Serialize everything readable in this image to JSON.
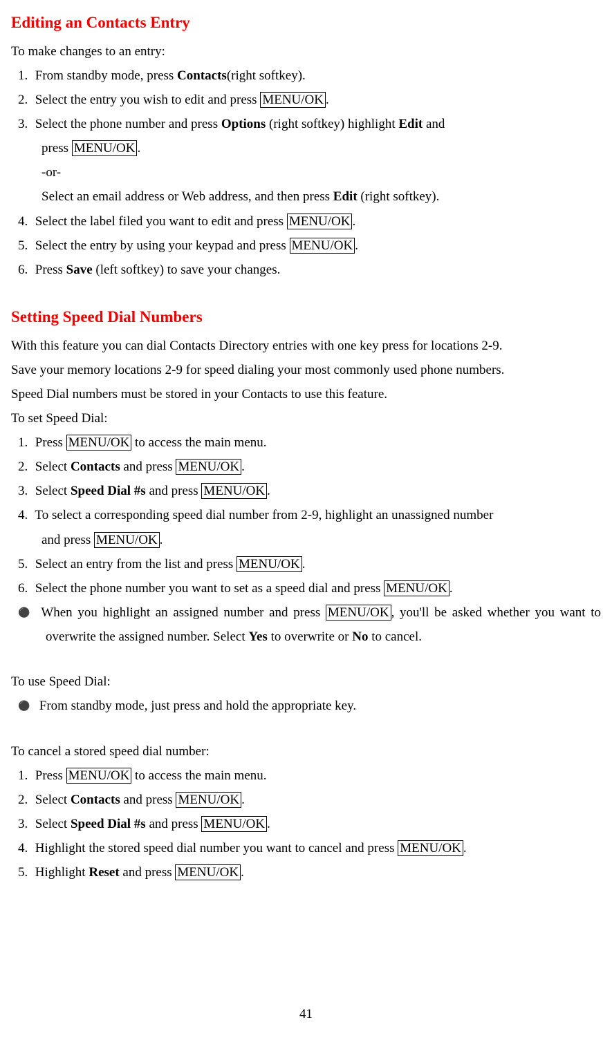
{
  "section1": {
    "title": "Editing an Contacts Entry",
    "intro": "To make changes to an entry:",
    "items": [
      {
        "num": "1.",
        "pre": "From standby mode, press ",
        "b1": "Contacts",
        "post": "(right softkey)."
      },
      {
        "num": "2.",
        "pre": "Select the entry you wish to edit and press ",
        "key1": "MENU/OK",
        "post": "."
      },
      {
        "num": "3.",
        "pre": "Select the phone number and press ",
        "b1": "Options",
        "mid1": " (right softkey) highlight ",
        "b2": "Edit",
        "mid2": " and",
        "cont_pre": "press ",
        "cont_key": "MENU/OK",
        "cont_post": ".",
        "or": "-or-",
        "alt_pre": "Select an email address or Web address, and then press ",
        "alt_b": "Edit",
        "alt_post": " (right softkey)."
      },
      {
        "num": "4.",
        "pre": "Select the label filed you want to edit and press ",
        "key1": "MENU/OK",
        "post": "."
      },
      {
        "num": "5.",
        "pre": "Select the entry by using your keypad and press ",
        "key1": "MENU/OK",
        "post": "."
      },
      {
        "num": "6.",
        "pre": "Press ",
        "b1": "Save",
        "post": " (left softkey) to save your changes."
      }
    ]
  },
  "section2": {
    "title": "Setting Speed Dial Numbers",
    "p1": "With this feature you can dial Contacts Directory entries with one key press for locations 2-9.",
    "p2": "Save your memory locations 2-9 for speed dialing your most commonly used phone numbers.",
    "p3": "Speed Dial numbers must be stored in your Contacts to use this feature.",
    "p4": "To set Speed Dial:",
    "items": [
      {
        "num": "1.",
        "pre": "Press ",
        "key1": "MENU/OK",
        "post": " to access the main menu."
      },
      {
        "num": "2.",
        "pre": "Select ",
        "b1": "Contacts",
        "mid1": " and press ",
        "key1": "MENU/OK",
        "post": "."
      },
      {
        "num": "3.",
        "pre": "Select ",
        "b1": "Speed Dial #s",
        "mid1": " and press ",
        "key1": "MENU/OK",
        "post": "."
      },
      {
        "num": "4.",
        "pre": "To select a corresponding speed dial number from 2-9, highlight an unassigned number",
        "cont_pre": "and press ",
        "cont_key": "MENU/OK",
        "cont_post": "."
      },
      {
        "num": "5.",
        "pre": "Select an entry from the list and press ",
        "key1": "MENU/OK",
        "post": "."
      },
      {
        "num": "6.",
        "pre": "Select the phone number you want to set as a speed dial and press ",
        "key1": "MENU/OK",
        "post": "."
      }
    ],
    "bullet1": {
      "pre": "When you highlight an assigned number and press ",
      "key": "MENU/OK",
      "mid": ", you'll be asked whether you want to overwrite the assigned number. Select ",
      "b1": "Yes",
      "mid2": " to overwrite or ",
      "b2": "No",
      "post": " to cancel."
    },
    "use_heading": "To use Speed Dial:",
    "use_bullet": "From standby mode, just press and hold the appropriate key.",
    "cancel_heading": "To cancel a stored speed dial number:",
    "cancel_items": [
      {
        "num": "1.",
        "pre": "Press ",
        "key1": "MENU/OK",
        "post": " to access the main menu."
      },
      {
        "num": "2.",
        "pre": "Select ",
        "b1": "Contacts",
        "mid1": " and press ",
        "key1": "MENU/OK",
        "post": "."
      },
      {
        "num": "3.",
        "pre": "Select ",
        "b1": "Speed Dial #s",
        "mid1": " and press ",
        "key1": "MENU/OK",
        "post": "."
      },
      {
        "num": "4.",
        "pre": "Highlight the stored speed dial number you want to cancel and press ",
        "key1": "MENU/OK",
        "post": "."
      },
      {
        "num": "5.",
        "pre": "Highlight ",
        "b1": "Reset",
        "mid1": " and press ",
        "key1": "MENU/OK",
        "post": "."
      }
    ]
  },
  "pagenum": "41"
}
